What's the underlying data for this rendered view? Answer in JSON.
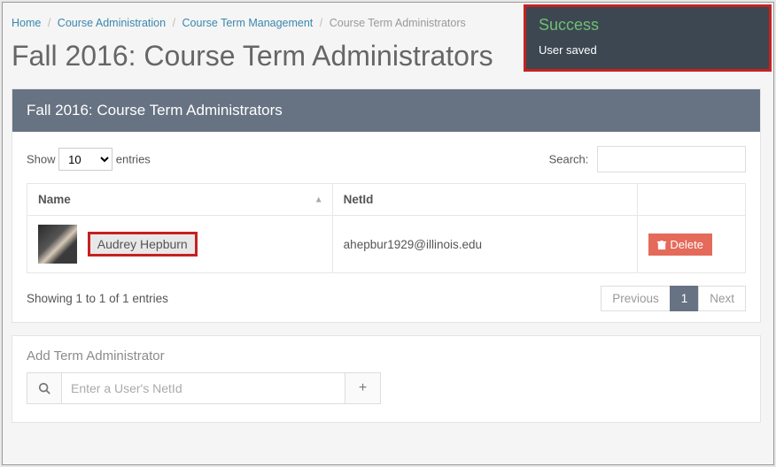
{
  "breadcrumb": {
    "home": "Home",
    "admin": "Course Administration",
    "term_mgmt": "Course Term Management",
    "current": "Course Term Administrators"
  },
  "page_title": "Fall 2016: Course Term Administrators",
  "panel_title": "Fall 2016: Course Term Administrators",
  "datatable": {
    "show_label_pre": "Show",
    "show_label_post": "entries",
    "length_value": "10",
    "search_label": "Search:",
    "columns": {
      "name": "Name",
      "netid": "NetId"
    },
    "rows": [
      {
        "name": "Audrey Hepburn",
        "netid": "ahepbur1929@illinois.edu",
        "delete_label": "Delete"
      }
    ],
    "info": "Showing 1 to 1 of 1 entries",
    "pager": {
      "prev": "Previous",
      "page": "1",
      "next": "Next"
    }
  },
  "add": {
    "title": "Add Term Administrator",
    "placeholder": "Enter a User's NetId"
  },
  "toast": {
    "title": "Success",
    "message": "User saved"
  }
}
